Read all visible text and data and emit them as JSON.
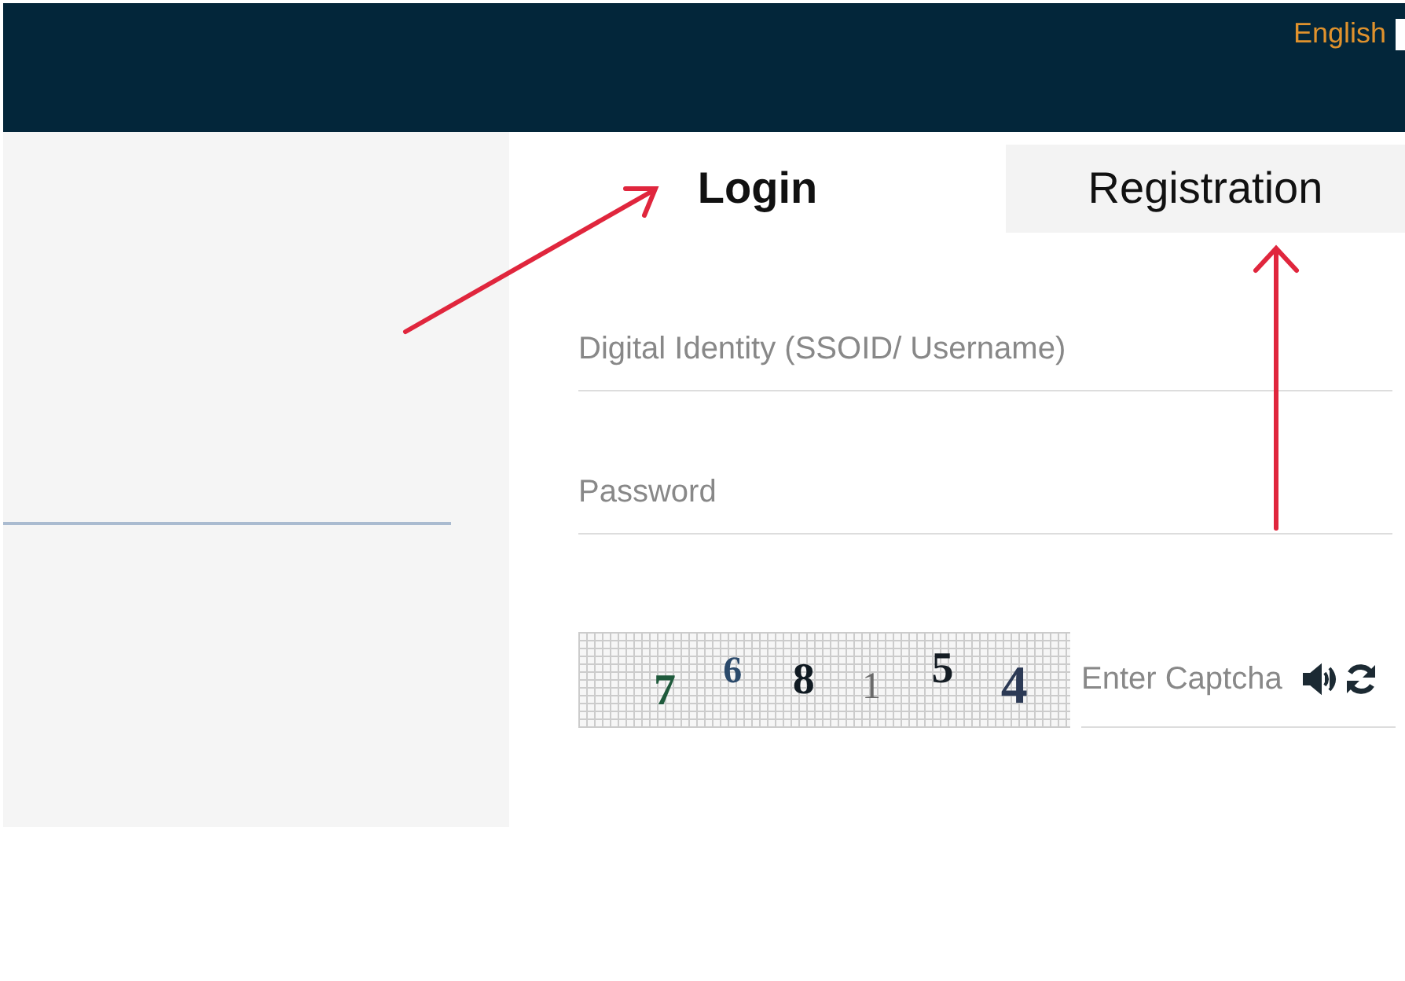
{
  "header": {
    "language": "English"
  },
  "tabs": [
    {
      "label": "Login",
      "selected": true
    },
    {
      "label": "Registration",
      "selected": false
    }
  ],
  "fields": [
    {
      "placeholder": "Digital Identity (SSOID/ Username)"
    },
    {
      "placeholder": "Password"
    }
  ],
  "captcha": {
    "digits": [
      {
        "text": "7",
        "color": "#1f5a3c"
      },
      {
        "text": "6",
        "color": "#2b4a6b"
      },
      {
        "text": "8",
        "color": "#101a22"
      },
      {
        "text": "1",
        "color": "#6a6a6a"
      },
      {
        "text": "5",
        "color": "#151d24"
      },
      {
        "text": "4",
        "color": "#2c3a55"
      }
    ],
    "placeholder": "Enter Captcha"
  }
}
